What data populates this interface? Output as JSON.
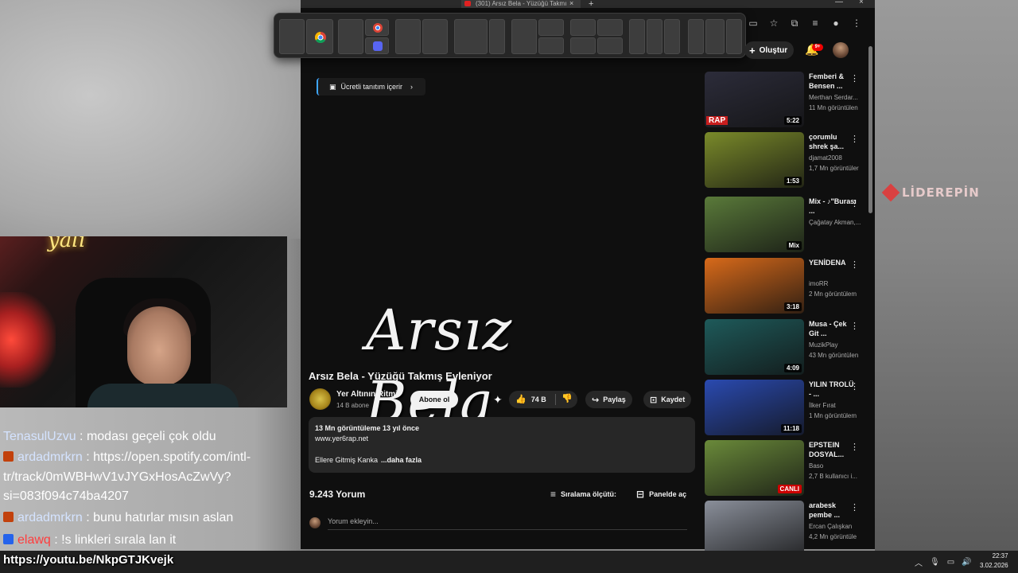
{
  "browser": {
    "tab_title": "(301) Arsız Bela - Yüzüğü Takmı",
    "tab_close": "×",
    "new_tab": "+",
    "win_min": "—",
    "win_close": "×"
  },
  "youtube": {
    "create_label": "Oluştur",
    "notif_count": "9+",
    "promo_label": "Ücretli tanıtım içerir",
    "video_art_text": "Arsız Bela",
    "video_title": "Arsız Bela - Yüzüğü Takmış Evleniyor",
    "channel_name": "Yer Altının Ritmi",
    "channel_subs": "14 B abone",
    "subscribe_label": "Abone ol",
    "like_count": "74 B",
    "share_label": "Paylaş",
    "save_label": "Kaydet",
    "desc_meta": "13 Mn görüntüleme  13 yıl önce",
    "desc_url": "www.yer6rap.net",
    "desc_line": "Ellere Gitmiş Kanka",
    "desc_more": "...daha fazla",
    "comments_count": "9.243 Yorum",
    "sort_label": "Sıralama ölçütü:",
    "panel_label": "Panelde aç",
    "comment_placeholder": "Yorum ekleyin..."
  },
  "recommendations": [
    {
      "title": "Femberi & Bensen ...",
      "channel": "Merthan Serdar...",
      "views": "11 Mn görüntülen",
      "duration": "5:22",
      "thumb": "#2c2c3a",
      "label": "RAP"
    },
    {
      "title": "çorumlu shrek şa...",
      "channel": "djamat2008",
      "views": "1,7 Mn görüntüler",
      "duration": "1:53",
      "thumb": "#7a8a2a"
    },
    {
      "title": "Mix - ♪\"Burası ...",
      "channel": "Çağatay Akman,...",
      "views": "",
      "duration": "Mix",
      "thumb": "#5a7a3a"
    },
    {
      "title": "YENİDENA",
      "channel": "imoRR",
      "views": "2 Mn görüntülem",
      "duration": "3:18",
      "thumb": "#d86a1a"
    },
    {
      "title": "Musa - Çek Git ...",
      "channel": "MuzikPlay",
      "views": "43 Mn görüntülen",
      "duration": "4:09",
      "thumb": "#1e5a5a"
    },
    {
      "title": "YILIN TROLÜ - ...",
      "channel": "İlker Fırat",
      "views": "1 Mn görüntülem",
      "duration": "11:18",
      "thumb": "#2a4ab0"
    },
    {
      "title": "EPSTEIN DOSYAL...",
      "channel": "Baso",
      "views": "2,7 B kullanıcı i...",
      "duration": "CANLI",
      "thumb": "#6a8a3a"
    },
    {
      "title": "arabesk pembe ...",
      "channel": "Ercan Çalışkan",
      "views": "4,2 Mn görüntüle",
      "duration": "",
      "thumb": "#8a8f9a"
    }
  ],
  "chat": [
    {
      "user": "TenasulUzvu",
      "msg": " : modası geçeli çok oldu",
      "style": "blue",
      "badge": ""
    },
    {
      "user": "ardadmrkrn",
      "msg": " : https://open.spotify.com/intl-",
      "style": "blue",
      "badge": "#c2410c"
    },
    {
      "user": "",
      "msg": "tr/track/0mWBHwV1vJYGxHosAcZwVy?",
      "style": "",
      "badge": ""
    },
    {
      "user": "",
      "msg": "si=083f094c74ba4207",
      "style": "",
      "badge": ""
    },
    {
      "user": "ardadmrkrn",
      "msg": " : bunu hatırlar mısın aslan",
      "style": "blue",
      "badge": "#c2410c"
    },
    {
      "user": "elawq",
      "msg": " : !s linkleri sırala lan it",
      "style": "red",
      "badge": "#2563eb"
    }
  ],
  "link_overlay": "https://youtu.be/NkpGTJKvejk",
  "watermark": "LİDEREPİN",
  "webcam_neon": "yalı",
  "clock": {
    "time": "22:37",
    "date": "3.02.2026"
  },
  "colors": {
    "yt_bg": "#0f0f0f",
    "pill": "#272727",
    "accent_red": "#cc0000"
  }
}
